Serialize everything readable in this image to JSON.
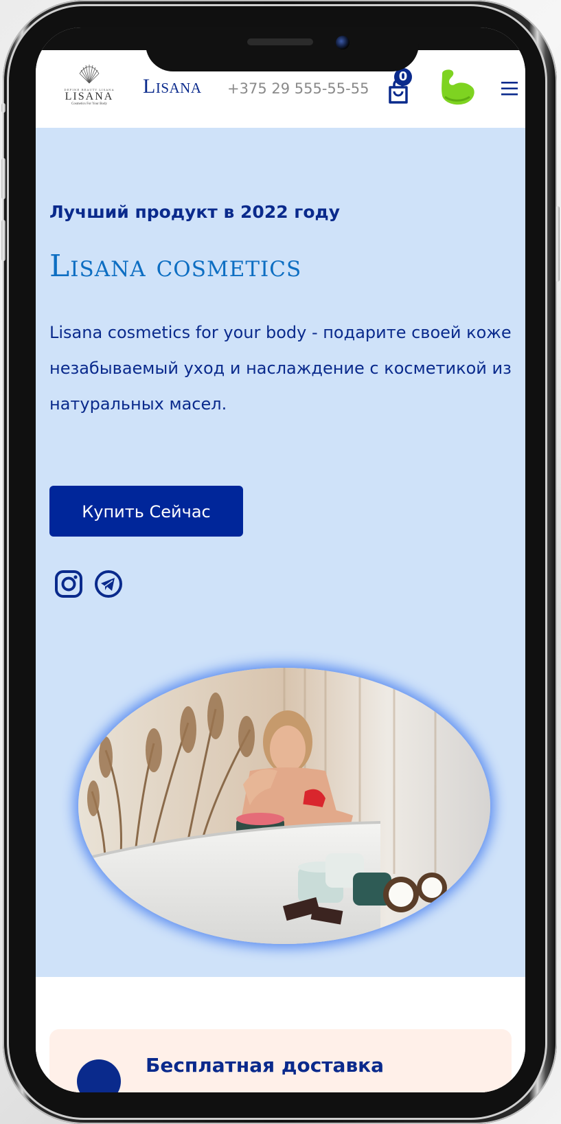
{
  "header": {
    "logo_small": "DEFINE  BEAUTY  LISANA",
    "logo_name": "LISANA",
    "logo_tagline": "Cosmetics For Your Body",
    "brand": "Lisana",
    "phone": "+375 29 555-55-55",
    "cart_count": "0",
    "icons": [
      "cart-icon",
      "avatar-icon",
      "menu-icon"
    ]
  },
  "hero": {
    "eyebrow": "Лучший продукт в 2022 году",
    "title": "Lisana cosmetics",
    "description": "Lisana cosmetics for your body - подарите своей коже незабываемый уход и наслаждение с косметикой из натуральных масел.",
    "cta": "Купить Сейчас",
    "social_icons": [
      "instagram-icon",
      "telegram-icon"
    ],
    "jar_label": "LISANA"
  },
  "features": {
    "first_title": "Бесплатная доставка"
  },
  "colors": {
    "primary": "#0a2a8c",
    "button": "#00269a",
    "hero_bg": "#cfe2f9",
    "title_accent": "#0d6ec2",
    "card_bg": "#fff0e9",
    "avatar_green": "#7ed321"
  }
}
